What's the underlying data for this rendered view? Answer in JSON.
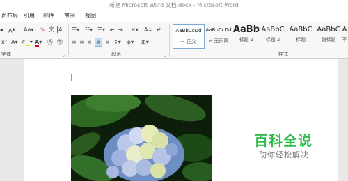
{
  "window": {
    "title": "新建 Microsoft Word 文档.docx - Microsoft Word"
  },
  "tabs": [
    {
      "label": "页布局"
    },
    {
      "label": "引用"
    },
    {
      "label": "邮件"
    },
    {
      "label": "审阅"
    },
    {
      "label": "视图"
    }
  ],
  "ribbon": {
    "font_group": {
      "label": "字体",
      "case_button": "Aa",
      "font_color_letter": "A",
      "clear_format_letter": "A"
    },
    "paragraph_group": {
      "label": "段落"
    },
    "styles_group": {
      "label": "样式",
      "items": [
        {
          "sample": "AaBbCcDd",
          "name": "↵ 正文",
          "selected": true
        },
        {
          "sample": "AaBbCcDd",
          "name": "↵ 无间隔",
          "selected": false
        },
        {
          "sample": "AaBb",
          "name": "标题 1",
          "selected": false
        },
        {
          "sample": "AaBbC",
          "name": "标题 2",
          "selected": false
        },
        {
          "sample": "AaBbC",
          "name": "标题",
          "selected": false
        },
        {
          "sample": "AaBbC",
          "name": "副标题",
          "selected": false
        },
        {
          "sample": "A",
          "name": "不",
          "selected": false
        }
      ]
    }
  },
  "watermark": {
    "title": "百科全说",
    "subtitle": "助你轻松解决"
  },
  "colors": {
    "highlight": "#ffe600",
    "font_color": "#e0001b",
    "watermark_green": "#2ebd4b",
    "selected_style_border": "#7ea9d7"
  }
}
